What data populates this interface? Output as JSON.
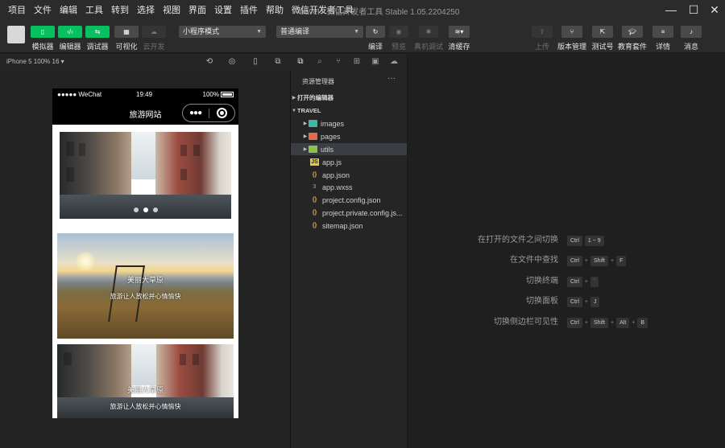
{
  "menubar": {
    "items": [
      "项目",
      "文件",
      "编辑",
      "工具",
      "转到",
      "选择",
      "视图",
      "界面",
      "设置",
      "插件",
      "帮助",
      "微信开发者工具"
    ],
    "window_title": "travel - 微信开发者工具 Stable 1.05.2204250",
    "controls": {
      "minimize": "—",
      "maximize": "☐",
      "close": "✕"
    }
  },
  "toolbar": {
    "simulator_label": "模拟器",
    "editor_label": "编辑器",
    "debugger_label": "调试器",
    "visual_label": "可视化",
    "cloud_label": "云开发",
    "mode_select": "小程序模式",
    "compile_select": "普通编译",
    "compile_label": "编译",
    "preview_label": "预览",
    "remote_debug_label": "真机调试",
    "clear_cache_label": "清缓存",
    "upload_label": "上传",
    "version_label": "版本管理",
    "test_label": "测试号",
    "edu_label": "教育套件",
    "details_label": "详情",
    "messages_label": "消息"
  },
  "simulator": {
    "device_label": "iPhone 5 100% 16 ▾",
    "status": {
      "carrier": "●●●●● WeChat",
      "time": "19:49",
      "battery": "100%"
    },
    "nav_title": "旅游网站",
    "cards": [
      {
        "title": "美丽大草原",
        "subtitle": "旅游让人放松并心情愉快"
      },
      {
        "title": "美丽大草原",
        "subtitle": "旅游让人放松并心情愉快"
      }
    ]
  },
  "explorer": {
    "title": "资源管理器",
    "more": "···",
    "open_editors": "打开的编辑器",
    "project": "TRAVEL",
    "items": [
      {
        "name": "images",
        "type": "folder",
        "color": "#3fb6a8"
      },
      {
        "name": "pages",
        "type": "folder",
        "color": "#e06c4f"
      },
      {
        "name": "utils",
        "type": "folder",
        "color": "#8bc34a"
      },
      {
        "name": "app.js",
        "type": "js"
      },
      {
        "name": "app.json",
        "type": "json"
      },
      {
        "name": "app.wxss",
        "type": "css"
      },
      {
        "name": "project.config.json",
        "type": "json"
      },
      {
        "name": "project.private.config.js...",
        "type": "json"
      },
      {
        "name": "sitemap.json",
        "type": "json"
      }
    ]
  },
  "shortcuts": [
    {
      "label": "在打开的文件之间切换",
      "keys": [
        "Ctrl",
        "1 ~ 9"
      ]
    },
    {
      "label": "在文件中查找",
      "keys": [
        "Ctrl",
        "+",
        "Shift",
        "+",
        "F"
      ]
    },
    {
      "label": "切换终端",
      "keys": [
        "Ctrl",
        "+",
        "`"
      ]
    },
    {
      "label": "切换面板",
      "keys": [
        "Ctrl",
        "+",
        "J"
      ]
    },
    {
      "label": "切换侧边栏可见性",
      "keys": [
        "Ctrl",
        "+",
        "Shift",
        "+",
        "Alt",
        "+",
        "B"
      ]
    }
  ]
}
